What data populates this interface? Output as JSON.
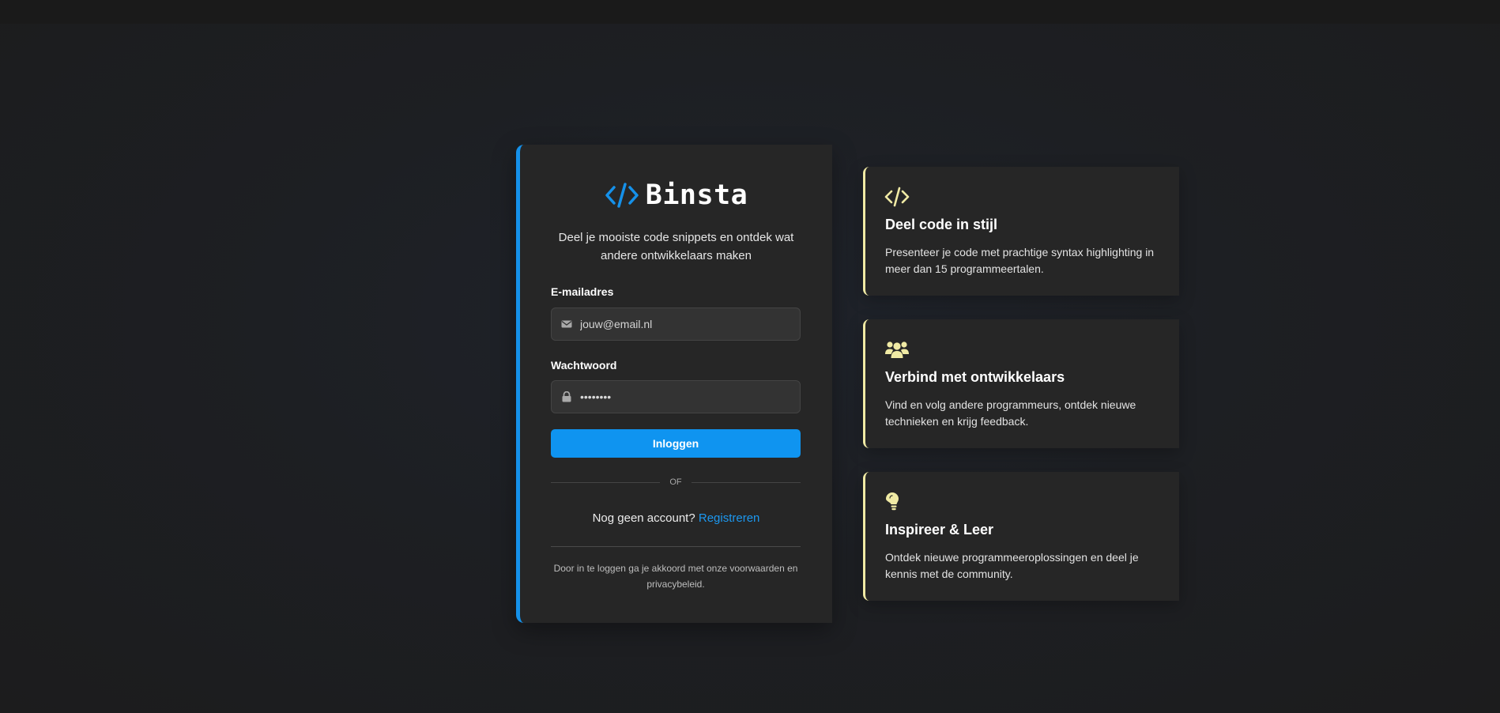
{
  "brand": {
    "name": "Binsta",
    "icon": "code-brackets-icon",
    "accent_color": "#1591ea"
  },
  "login": {
    "tagline": "Deel je mooiste code snippets en ontdek wat andere ontwikkelaars maken",
    "email_label": "E-mailadres",
    "email_placeholder": "jouw@email.nl",
    "email_icon": "envelope-icon",
    "password_label": "Wachtwoord",
    "password_value": "••••••••",
    "password_icon": "lock-icon",
    "submit_label": "Inloggen",
    "button_color": "#0f94f0",
    "divider_text": "OF",
    "no_account_text": "Nog geen account?",
    "register_label": "Registreren",
    "terms_text": "Door in te loggen ga je akkoord met onze voorwaarden en privacybeleid."
  },
  "features": [
    {
      "icon": "code-icon",
      "title": "Deel code in stijl",
      "text": "Presenteer je code met prachtige syntax highlighting in meer dan 15 programmeertalen."
    },
    {
      "icon": "users-icon",
      "title": "Verbind met ontwikkelaars",
      "text": "Vind en volg andere programmeurs, ontdek nieuwe technieken en krijg feedback."
    },
    {
      "icon": "lightbulb-icon",
      "title": "Inspireer & Leer",
      "text": "Ontdek nieuwe programmeeroplossingen en deel je kennis met de community."
    }
  ],
  "feature_accent_color": "#f0eaa4"
}
